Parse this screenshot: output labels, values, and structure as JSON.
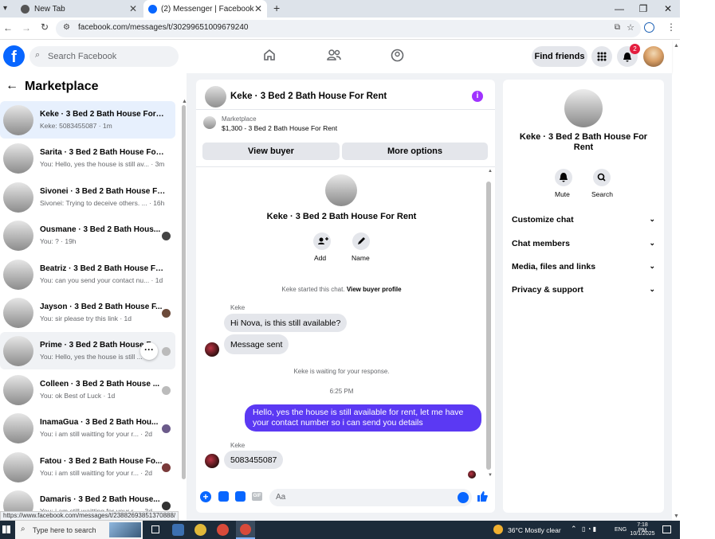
{
  "browser": {
    "tabs": [
      {
        "label": "New Tab",
        "icon": "chrome-icon"
      },
      {
        "label": "(2) Messenger | Facebook",
        "icon": "facebook-icon"
      }
    ],
    "url": "facebook.com/messages/t/30299651009679240",
    "status_url": "https://www.facebook.com/messages/t/23882693851370888/"
  },
  "fb_header": {
    "search_placeholder": "Search Facebook",
    "find_friends": "Find friends",
    "notif_count": "2"
  },
  "sidebar": {
    "title": "Marketplace",
    "conversations": [
      {
        "title": "Keke · 3 Bed 2 Bath House For R...",
        "snippet": "Keke: 5083455087 · 1m",
        "state": "active"
      },
      {
        "title": "Sarita · 3 Bed 2 Bath House For ...",
        "snippet": "You: Hello, yes the house is still av... · 3m"
      },
      {
        "title": "Sivonei · 3 Bed 2 Bath House For...",
        "snippet": "Sivonei: Trying to deceive others. ... · 16h"
      },
      {
        "title": "Ousmane · 3 Bed 2 Bath Hous...",
        "snippet": "You: ? · 19h"
      },
      {
        "title": "Beatriz · 3 Bed 2 Bath House For...",
        "snippet": "You: can you send your contact nu... · 1d"
      },
      {
        "title": "Jayson · 3 Bed 2 Bath House F...",
        "snippet": "You: sir please try this link · 1d"
      },
      {
        "title": "Prime · 3 Bed 2 Bath House F...",
        "snippet": "You: Hello, yes the house is still ...",
        "state": "hover"
      },
      {
        "title": "Colleen · 3 Bed 2 Bath House ...",
        "snippet": "You: ok Best of Luck · 1d"
      },
      {
        "title": "InamaGua · 3 Bed 2 Bath Hou...",
        "snippet": "You: i am still waitting for your r... · 2d"
      },
      {
        "title": "Fatou · 3 Bed 2 Bath House Fo...",
        "snippet": "You: i am still waitting for your r... · 2d"
      },
      {
        "title": "Damaris · 3 Bed 2 Bath House...",
        "snippet": "You: i am still waitting for your r... · 3d"
      }
    ]
  },
  "chat": {
    "header_title": "Keke · 3 Bed 2 Bath House For Rent",
    "listing_label": "Marketplace",
    "listing_price": "$1,300 - 3 Bed 2 Bath House For Rent",
    "view_buyer": "View buyer",
    "more_options": "More options",
    "profile_name": "Keke · 3 Bed 2 Bath House For Rent",
    "add_label": "Add",
    "name_label": "Name",
    "started_text": "Keke started this chat.",
    "view_buyer_profile": "View buyer profile",
    "sender_name": "Keke",
    "msg1": "Hi Nova, is this still available?",
    "msg2": "Message sent",
    "waiting": "Keke is waiting for your response.",
    "time": "6:25 PM",
    "my_msg": "Hello, yes the house is still available for rent, let me have your contact number so i can send you  details",
    "sender_name2": "Keke",
    "msg3": "5083455087",
    "composer_placeholder": "Aa"
  },
  "right_panel": {
    "name": "Keke · 3 Bed 2 Bath House For Rent",
    "mute": "Mute",
    "search": "Search",
    "rows": [
      "Customize chat",
      "Chat members",
      "Media, files and links",
      "Privacy & support"
    ]
  },
  "taskbar": {
    "search_placeholder": "Type here to search",
    "weather": "36°C  Mostly clear",
    "lang": "ENG",
    "time": "7:18 PM",
    "date": "10/1/2025"
  },
  "colors": {
    "fb_blue": "#0866ff",
    "my_bubble": "#5b39f3",
    "notif_red": "#e41e3f",
    "info_purple": "#a033ff"
  }
}
